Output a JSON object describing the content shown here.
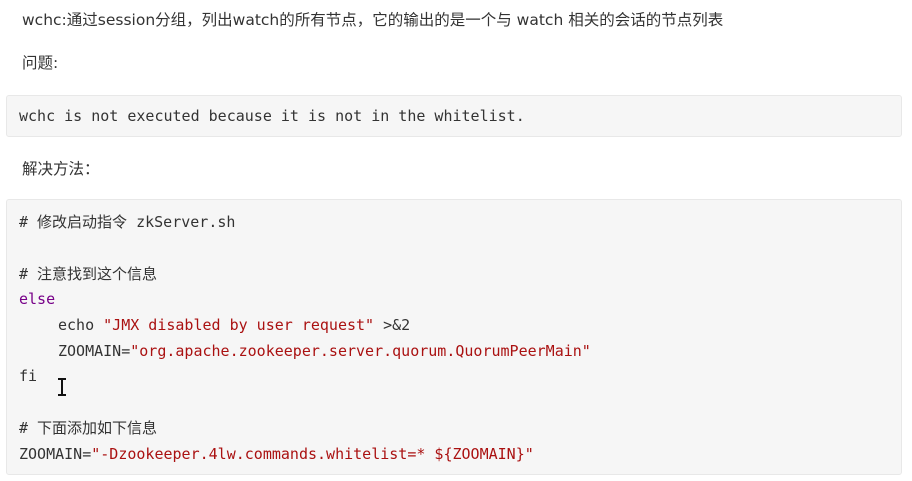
{
  "paragraphs": {
    "intro": "wchc:通过session分组，列出watch的所有节点，它的输出的是一个与 watch 相关的会话的节点列表",
    "problem": "问题:",
    "solution": "解决方法："
  },
  "code_block_1": {
    "line1": "wchc is not executed because it is not in the whitelist."
  },
  "code_block_2": {
    "comment_modify": "# 修改启动指令 zkServer.sh",
    "comment_find": "# 注意找到这个信息",
    "kw_else": "else",
    "echo_cmd": "echo ",
    "echo_str": "\"JMX disabled by user request\"",
    "echo_redirect": " >&2",
    "zoomain_assign1": "ZOOMAIN=",
    "zoomain_str1": "\"org.apache.zookeeper.server.quorum.QuorumPeerMain\"",
    "kw_fi": "fi",
    "comment_add": "# 下面添加如下信息",
    "zoomain_assign2": "ZOOMAIN=",
    "zoomain_str2": "\"-Dzookeeper.4lw.commands.whitelist=* ${ZOOMAIN}\""
  },
  "colors": {
    "keyword": "#770088",
    "string": "#aa1111",
    "text": "#333333",
    "code_background": "#f6f6f6"
  },
  "icons": {
    "cursor": "text-cursor-icon"
  }
}
